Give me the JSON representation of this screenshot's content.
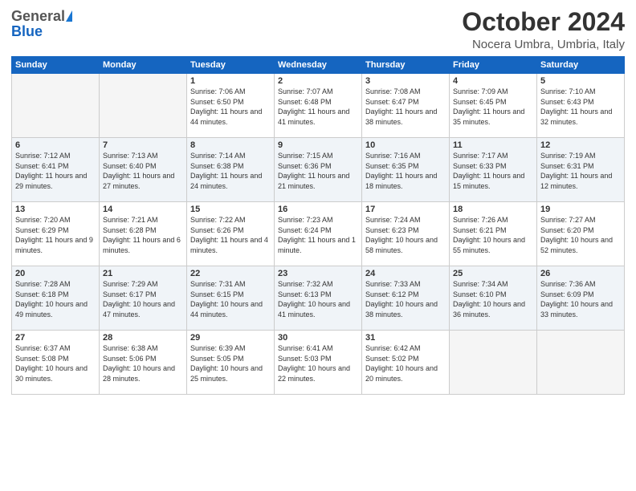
{
  "logo": {
    "general": "General",
    "blue": "Blue"
  },
  "header": {
    "month": "October 2024",
    "location": "Nocera Umbra, Umbria, Italy"
  },
  "columns": [
    "Sunday",
    "Monday",
    "Tuesday",
    "Wednesday",
    "Thursday",
    "Friday",
    "Saturday"
  ],
  "weeks": [
    [
      {
        "day": "",
        "empty": true
      },
      {
        "day": "",
        "empty": true
      },
      {
        "day": "1",
        "sunrise": "Sunrise: 7:06 AM",
        "sunset": "Sunset: 6:50 PM",
        "daylight": "Daylight: 11 hours and 44 minutes."
      },
      {
        "day": "2",
        "sunrise": "Sunrise: 7:07 AM",
        "sunset": "Sunset: 6:48 PM",
        "daylight": "Daylight: 11 hours and 41 minutes."
      },
      {
        "day": "3",
        "sunrise": "Sunrise: 7:08 AM",
        "sunset": "Sunset: 6:47 PM",
        "daylight": "Daylight: 11 hours and 38 minutes."
      },
      {
        "day": "4",
        "sunrise": "Sunrise: 7:09 AM",
        "sunset": "Sunset: 6:45 PM",
        "daylight": "Daylight: 11 hours and 35 minutes."
      },
      {
        "day": "5",
        "sunrise": "Sunrise: 7:10 AM",
        "sunset": "Sunset: 6:43 PM",
        "daylight": "Daylight: 11 hours and 32 minutes."
      }
    ],
    [
      {
        "day": "6",
        "sunrise": "Sunrise: 7:12 AM",
        "sunset": "Sunset: 6:41 PM",
        "daylight": "Daylight: 11 hours and 29 minutes."
      },
      {
        "day": "7",
        "sunrise": "Sunrise: 7:13 AM",
        "sunset": "Sunset: 6:40 PM",
        "daylight": "Daylight: 11 hours and 27 minutes."
      },
      {
        "day": "8",
        "sunrise": "Sunrise: 7:14 AM",
        "sunset": "Sunset: 6:38 PM",
        "daylight": "Daylight: 11 hours and 24 minutes."
      },
      {
        "day": "9",
        "sunrise": "Sunrise: 7:15 AM",
        "sunset": "Sunset: 6:36 PM",
        "daylight": "Daylight: 11 hours and 21 minutes."
      },
      {
        "day": "10",
        "sunrise": "Sunrise: 7:16 AM",
        "sunset": "Sunset: 6:35 PM",
        "daylight": "Daylight: 11 hours and 18 minutes."
      },
      {
        "day": "11",
        "sunrise": "Sunrise: 7:17 AM",
        "sunset": "Sunset: 6:33 PM",
        "daylight": "Daylight: 11 hours and 15 minutes."
      },
      {
        "day": "12",
        "sunrise": "Sunrise: 7:19 AM",
        "sunset": "Sunset: 6:31 PM",
        "daylight": "Daylight: 11 hours and 12 minutes."
      }
    ],
    [
      {
        "day": "13",
        "sunrise": "Sunrise: 7:20 AM",
        "sunset": "Sunset: 6:29 PM",
        "daylight": "Daylight: 11 hours and 9 minutes."
      },
      {
        "day": "14",
        "sunrise": "Sunrise: 7:21 AM",
        "sunset": "Sunset: 6:28 PM",
        "daylight": "Daylight: 11 hours and 6 minutes."
      },
      {
        "day": "15",
        "sunrise": "Sunrise: 7:22 AM",
        "sunset": "Sunset: 6:26 PM",
        "daylight": "Daylight: 11 hours and 4 minutes."
      },
      {
        "day": "16",
        "sunrise": "Sunrise: 7:23 AM",
        "sunset": "Sunset: 6:24 PM",
        "daylight": "Daylight: 11 hours and 1 minute."
      },
      {
        "day": "17",
        "sunrise": "Sunrise: 7:24 AM",
        "sunset": "Sunset: 6:23 PM",
        "daylight": "Daylight: 10 hours and 58 minutes."
      },
      {
        "day": "18",
        "sunrise": "Sunrise: 7:26 AM",
        "sunset": "Sunset: 6:21 PM",
        "daylight": "Daylight: 10 hours and 55 minutes."
      },
      {
        "day": "19",
        "sunrise": "Sunrise: 7:27 AM",
        "sunset": "Sunset: 6:20 PM",
        "daylight": "Daylight: 10 hours and 52 minutes."
      }
    ],
    [
      {
        "day": "20",
        "sunrise": "Sunrise: 7:28 AM",
        "sunset": "Sunset: 6:18 PM",
        "daylight": "Daylight: 10 hours and 49 minutes."
      },
      {
        "day": "21",
        "sunrise": "Sunrise: 7:29 AM",
        "sunset": "Sunset: 6:17 PM",
        "daylight": "Daylight: 10 hours and 47 minutes."
      },
      {
        "day": "22",
        "sunrise": "Sunrise: 7:31 AM",
        "sunset": "Sunset: 6:15 PM",
        "daylight": "Daylight: 10 hours and 44 minutes."
      },
      {
        "day": "23",
        "sunrise": "Sunrise: 7:32 AM",
        "sunset": "Sunset: 6:13 PM",
        "daylight": "Daylight: 10 hours and 41 minutes."
      },
      {
        "day": "24",
        "sunrise": "Sunrise: 7:33 AM",
        "sunset": "Sunset: 6:12 PM",
        "daylight": "Daylight: 10 hours and 38 minutes."
      },
      {
        "day": "25",
        "sunrise": "Sunrise: 7:34 AM",
        "sunset": "Sunset: 6:10 PM",
        "daylight": "Daylight: 10 hours and 36 minutes."
      },
      {
        "day": "26",
        "sunrise": "Sunrise: 7:36 AM",
        "sunset": "Sunset: 6:09 PM",
        "daylight": "Daylight: 10 hours and 33 minutes."
      }
    ],
    [
      {
        "day": "27",
        "sunrise": "Sunrise: 6:37 AM",
        "sunset": "Sunset: 5:08 PM",
        "daylight": "Daylight: 10 hours and 30 minutes."
      },
      {
        "day": "28",
        "sunrise": "Sunrise: 6:38 AM",
        "sunset": "Sunset: 5:06 PM",
        "daylight": "Daylight: 10 hours and 28 minutes."
      },
      {
        "day": "29",
        "sunrise": "Sunrise: 6:39 AM",
        "sunset": "Sunset: 5:05 PM",
        "daylight": "Daylight: 10 hours and 25 minutes."
      },
      {
        "day": "30",
        "sunrise": "Sunrise: 6:41 AM",
        "sunset": "Sunset: 5:03 PM",
        "daylight": "Daylight: 10 hours and 22 minutes."
      },
      {
        "day": "31",
        "sunrise": "Sunrise: 6:42 AM",
        "sunset": "Sunset: 5:02 PM",
        "daylight": "Daylight: 10 hours and 20 minutes."
      },
      {
        "day": "",
        "empty": true
      },
      {
        "day": "",
        "empty": true
      }
    ]
  ]
}
